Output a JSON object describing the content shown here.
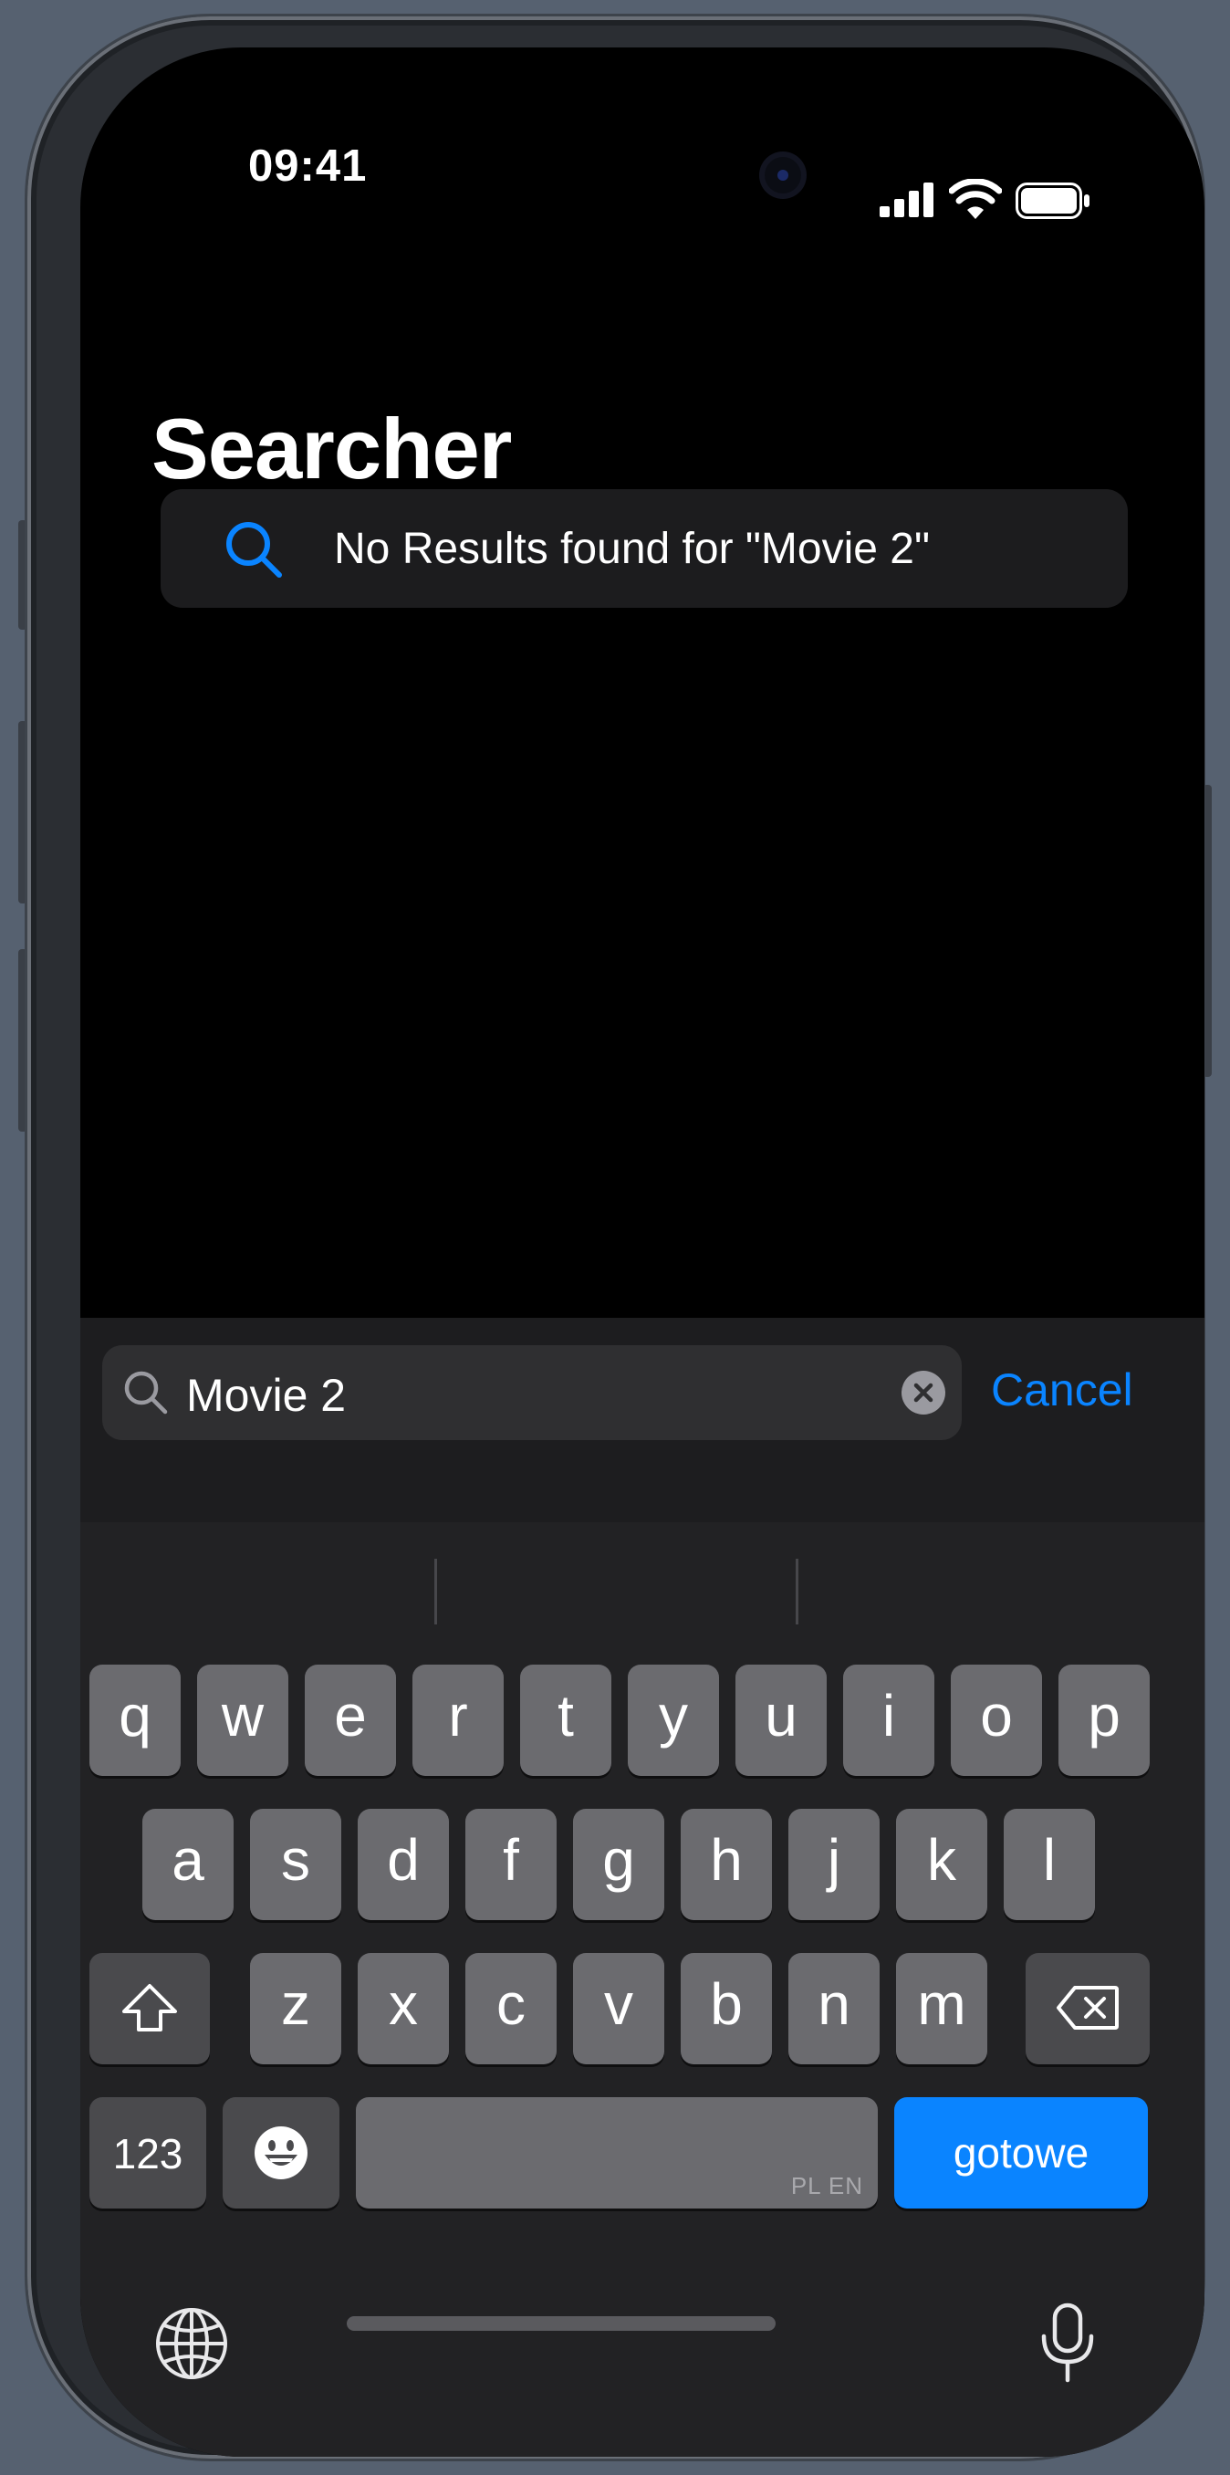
{
  "status_bar": {
    "time": "09:41"
  },
  "page": {
    "title": "Searcher"
  },
  "results": {
    "message": "No Results found for \"Movie 2\""
  },
  "search_bar": {
    "value": "Movie 2",
    "cancel_label": "Cancel"
  },
  "keyboard": {
    "row1": [
      "q",
      "w",
      "e",
      "r",
      "t",
      "y",
      "u",
      "i",
      "o",
      "p"
    ],
    "row2": [
      "a",
      "s",
      "d",
      "f",
      "g",
      "h",
      "j",
      "k",
      "l"
    ],
    "row3": [
      "z",
      "x",
      "c",
      "v",
      "b",
      "n",
      "m"
    ],
    "numbers_label": "123",
    "space_languages": "PL EN",
    "return_label": "gotowe"
  },
  "colors": {
    "accent": "#0A84FF",
    "background": "#000000",
    "key": "#6B6B6F"
  }
}
